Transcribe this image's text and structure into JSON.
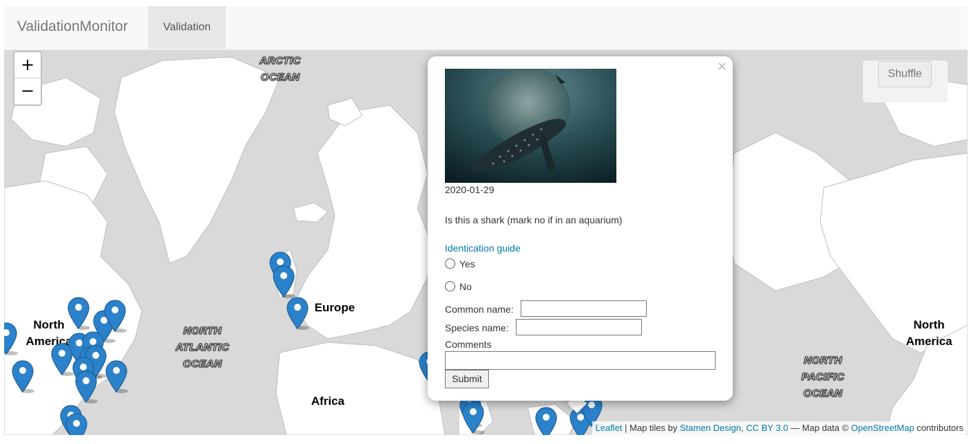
{
  "navbar": {
    "brand": "ValidationMonitor",
    "tab": "Validation"
  },
  "map": {
    "zoom_in": "+",
    "zoom_out": "−",
    "shuffle_label": "Shuffle",
    "labels": {
      "arctic": [
        "ARCTIC",
        "OCEAN"
      ],
      "north_atlantic": [
        "NORTH",
        "ATLANTIC",
        "OCEAN"
      ],
      "north_pacific": [
        "NORTH",
        "PACIFIC",
        "OCEAN"
      ],
      "north_america_left": [
        "North",
        "America"
      ],
      "north_america_right": [
        "North",
        "America"
      ],
      "europe": "Europe",
      "africa": "Africa"
    },
    "marker_color": "#2b82cb",
    "attribution": {
      "leaflet": "Leaflet",
      "sep1": " | Map tiles by ",
      "stamen": "Stamen Design",
      "comma": ", ",
      "cc": "CC BY 3.0",
      "sep2": " — Map data © ",
      "osm": "OpenStreetMap",
      "tail": " contributors"
    }
  },
  "popup": {
    "close": "×",
    "date": "2020-01-29",
    "question": "Is this a shark (mark no if in an aquarium)",
    "guide_link": "Identication guide",
    "options": [
      "Yes",
      "No"
    ],
    "common_name_label": "Common name:",
    "species_name_label": "Species name:",
    "comments_label": "Comments",
    "submit": "Submit"
  },
  "colors": {
    "land": "#ffffff",
    "water": "#d9d9d9",
    "link": "#0078a8"
  }
}
